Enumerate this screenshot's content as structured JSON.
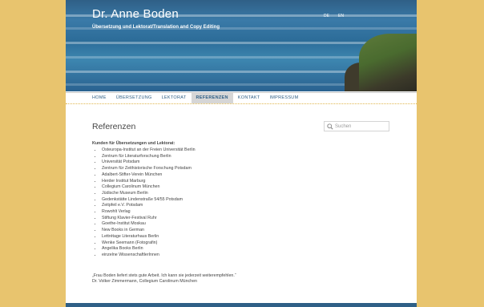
{
  "site": {
    "title": "Dr. Anne Boden",
    "description": "Übersetzung und Lektorat/Translation and Copy Editing",
    "languages": [
      "DE",
      "EN"
    ]
  },
  "nav": {
    "items": [
      "HOME",
      "ÜBERSETZUNG",
      "LEKTORAT",
      "REFERENZEN",
      "KONTAKT",
      "IMPRESSUM"
    ],
    "active": "REFERENZEN"
  },
  "search": {
    "placeholder": "Suchen"
  },
  "main": {
    "title": "Referenzen",
    "clients_heading": "Kunden für Übersetzungen und Lektorat:",
    "clients": [
      "Osteuropa-Institut an der Freien Universität Berlin",
      "Zentrum für Literaturforschung Berlin",
      "Universität Potsdam",
      "Zentrum für Zeithistorische Forschung Potsdam",
      "Adalbert-Stifter-Verein München",
      "Herder Institut Marburg",
      "Collegium Carolinum München",
      "Jüdische Museum Berlin",
      "Gedenkstätte Lindenstraße 54/55 Potsdam",
      "Zeitpfeil e.V. Potsdam",
      "Rowohlt Verlag",
      "Stiftung Klavier-Festival Ruhr",
      "Goethe-Institut Moskau",
      "New Books in German",
      "Lettrétage Literaturhaus Berlin",
      "Wenke Seemann (Fotografin)",
      "Angelika Books Berlin",
      "einzelne WissenschaftlerInnen"
    ],
    "quote": "„Frau Boden liefert stets gute Arbeit. Ich kann sie jederzeit weiterempfehlen.“",
    "quote_author": "Dr. Volker Zimmermann, Collegium Carolinum München"
  },
  "icons": {
    "search": "magnifier-icon"
  },
  "colors": {
    "background": "#e8c46e",
    "accent": "#2f5f86",
    "active_tab": "#d6d6d6"
  }
}
